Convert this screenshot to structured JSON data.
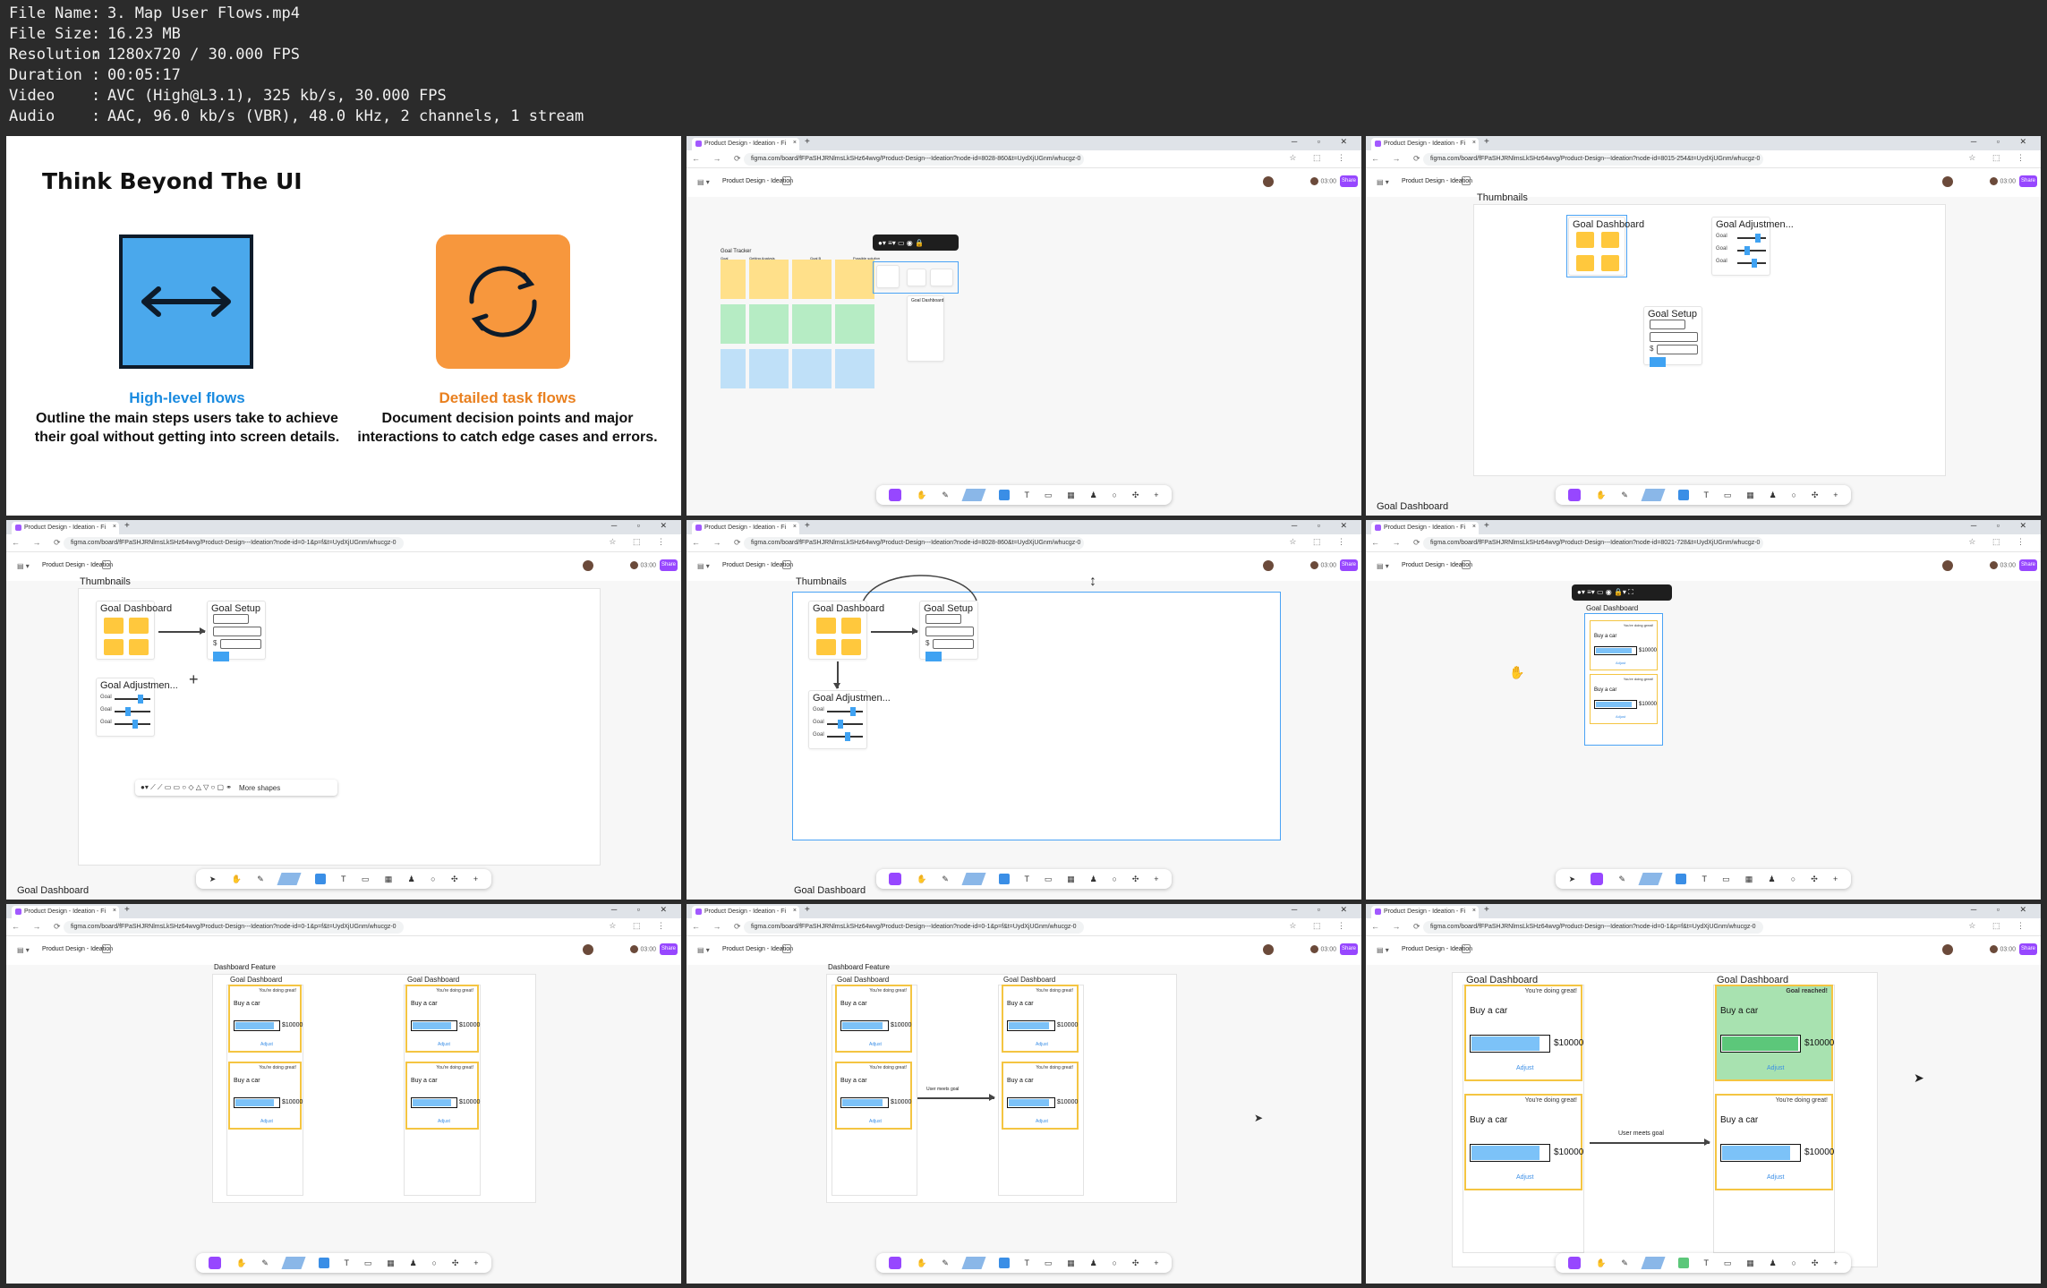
{
  "media_info": {
    "rows": [
      {
        "key": "File Name",
        "value": "3. Map User Flows.mp4"
      },
      {
        "key": "File Size",
        "value": "16.23 MB"
      },
      {
        "key": "Resolution",
        "value": "1280x720 / 30.000 FPS"
      },
      {
        "key": "Duration",
        "value": "00:05:17"
      },
      {
        "key": "Video",
        "value": "AVC (High@L3.1), 325 kb/s, 30.000 FPS"
      },
      {
        "key": "Audio",
        "value": "AAC, 96.0 kb/s (VBR), 48.0 kHz, 2 channels, 1 stream"
      }
    ]
  },
  "slide": {
    "title": "Think Beyond The UI",
    "col1": {
      "heading": "High-level flows",
      "body": "Outline the main steps users take to achieve their goal without getting into screen details."
    },
    "col2": {
      "heading": "Detailed task flows",
      "body": "Document decision points and major interactions to catch edge cases and errors."
    }
  },
  "browser": {
    "tab_title": "Product Design - Ideation - Fi",
    "close": "×",
    "new_tab": "+",
    "win_controls": "─ ▫ ✕",
    "nav": "← → ⟳ ⌂",
    "urls": [
      "figma.com/board/fFPaSHJRNlmsLkSHz64wvg/Product-Design---Ideation?node-id=8028-860&t=UydXjUGnm/whucgz-0",
      "figma.com/board/fFPaSHJRNlmsLkSHz64wvg/Product-Design---Ideation?node-id=8015-254&t=UydXjUGnm/whucgz-0",
      "figma.com/board/fFPaSHJRNlmsLkSHz64wvg/Product-Design---Ideation?node-id=0-1&p=f&t=UydXjUGnm/whucgz-0",
      "figma.com/board/fFPaSHJRNlmsLkSHz64wvg/Product-Design---Ideation?node-id=8028-860&t=UydXjUGnm/whucgz-0",
      "figma.com/board/fFPaSHJRNlmsLkSHz64wvg/Product-Design---Ideation?node-id=8021-728&t=UydXjUGnm/whucgz-0",
      "figma.com/board/fFPaSHJRNlmsLkSHz64wvg/Product-Design---Ideation?node-id=0-1&p=f&t=UydXjUGnm/whucgz-0",
      "figma.com/board/fFPaSHJRNlmsLkSHz64wvg/Product-Design---Ideation?node-id=0-1&p=f&t=UydXjUGnm/whucgz-0",
      "figma.com/board/fFPaSHJRNlmsLkSHz64wvg/Product-Design---Ideation?node-id=0-1&p=f&t=UydXjUGnm/whucgz-0"
    ],
    "addr_icons": "☆ ⬚ ⋮"
  },
  "figma": {
    "file_name": "Product Design - Ideation",
    "menu": "▤ ▾",
    "timer": "03:00",
    "share": "Share",
    "toolbar_icons": [
      "✋",
      "✎",
      "T",
      "▭",
      "▦",
      "♟",
      "○",
      "✣",
      "+"
    ],
    "zoom_controls": "− + ?",
    "section_thumbnails": "Thumbnails",
    "section_dashboard_feature": "Dashboard Feature",
    "bottom_label": "Goal Dashboard",
    "goal_tracker": "Goal Tracker",
    "tracker_cols": [
      "Goal",
      "Getting Analysis",
      "Goal B",
      "Possible solution"
    ],
    "goal_dashboard": "Goal Dashboard",
    "goal_setup": "Goal Setup",
    "goal_adjustment": "Goal Adjustmen...",
    "goal_label": "Goal",
    "dollar": "$",
    "encouragement": "You're doing great!",
    "goal_reached": "Goal reached!",
    "goal_name": "Buy a car",
    "amount": "$10000",
    "adjust": "Adjust",
    "user_meets_goal": "User meets goal",
    "more_shapes": "More shapes"
  }
}
